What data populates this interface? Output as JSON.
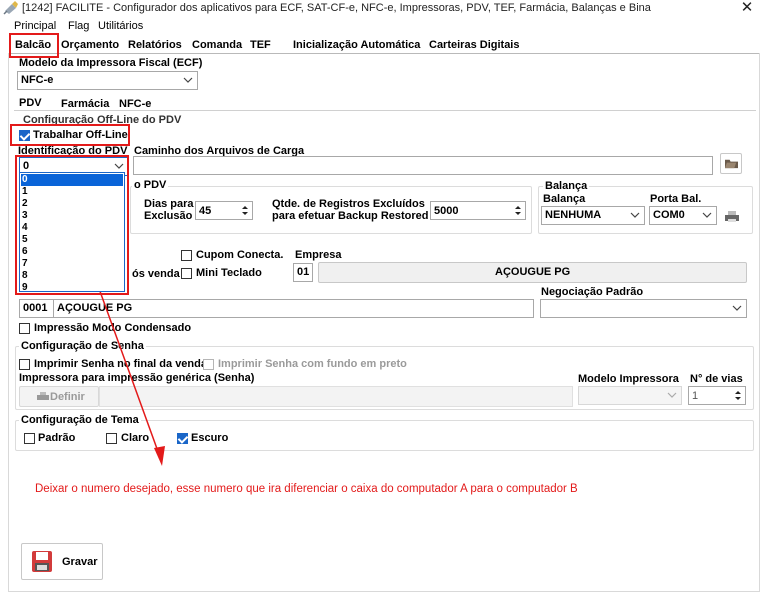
{
  "window": {
    "title": "[1242] FACILITE - Configurador dos aplicativos para ECF, SAT-CF-e, NFC-e, Impressoras, PDV, TEF, Farmácia, Balanças e Bina",
    "close": "✕"
  },
  "menu": [
    "Principal",
    "Flag",
    "Utilitários"
  ],
  "tabs": [
    "Balcão",
    "Orçamento",
    "Relatórios",
    "Comanda",
    "TEF",
    "Inicialização Automática",
    "Carteiras Digitais"
  ],
  "modelo_ecf": {
    "label": "Modelo da Impressora Fiscal (ECF)",
    "value": "NFC-e"
  },
  "subtabs": [
    "PDV",
    "Farmácia",
    "NFC-e"
  ],
  "offline": {
    "group_label": "Configuração Off-Line do PDV",
    "checkbox_label": "Trabalhar Off-Line",
    "checked": true,
    "id_label": "Identificação do PDV",
    "id_value": "0",
    "path_label": "Caminho dos Arquivos de Carga",
    "path_value": ""
  },
  "dropdown_options": [
    "0",
    "1",
    "2",
    "3",
    "4",
    "5",
    "6",
    "7",
    "8",
    "9"
  ],
  "backup": {
    "group_label_partial": "o PDV",
    "dias_label_1": "Dias para",
    "dias_label_2": "Exclusão",
    "dias_value": "45",
    "registros_label_1": "Qtde. de Registros Excluídos",
    "registros_label_2": "para efetuar Backup Restored",
    "registros_value": "5000"
  },
  "balanca": {
    "group_label": "Balança",
    "balanca_label": "Balança",
    "balanca_value": "NENHUMA",
    "porta_label": "Porta Bal.",
    "porta_value": "COM0"
  },
  "venda": {
    "partial_label": "ós venda",
    "cupom_conecta": "Cupom Conecta.",
    "mini_teclado": "Mini Teclado",
    "empresa_label": "Empresa",
    "empresa_code": "01",
    "empresa_name": "AÇOUGUE PG",
    "loja_code": "0001",
    "loja_name": "AÇOUGUE PG",
    "negociacao_label": "Negociação Padrão",
    "negociacao_value": "",
    "impressao_condensado": "Impressão Modo Condensado"
  },
  "senha": {
    "group_label": "Configuração de Senha",
    "imprimir_final": "Imprimir Senha no final da venda",
    "imprimir_fundo": "Imprimir Senha com fundo em preto",
    "impressora_label": "Impressora para impressão genérica (Senha)",
    "definir": "Definir",
    "modelo_label": "Modelo Impressora",
    "vias_label": "N° de vias",
    "vias_value": "1"
  },
  "tema": {
    "group_label": "Configuração de Tema",
    "padrao": "Padrão",
    "claro": "Claro",
    "escuro": "Escuro",
    "selected": "Escuro"
  },
  "annotation": "Deixar o numero desejado, esse numero que ira diferenciar o caixa do computador A para o computador B",
  "gravar": "Gravar",
  "colors": {
    "highlight": "#e31a1a",
    "accent": "#1a66c8",
    "selection": "#0a64d8"
  }
}
